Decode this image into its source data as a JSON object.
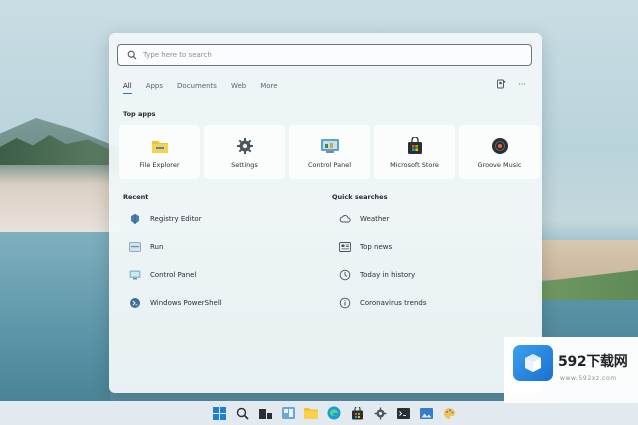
{
  "search": {
    "placeholder": "Type here to search"
  },
  "filters": [
    {
      "label": "All",
      "active": true
    },
    {
      "label": "Apps",
      "active": false
    },
    {
      "label": "Documents",
      "active": false
    },
    {
      "label": "Web",
      "active": false
    },
    {
      "label": "More",
      "active": false
    }
  ],
  "tools": {
    "more": "···"
  },
  "sections": {
    "top_apps": "Top apps",
    "recent": "Recent",
    "quick_searches": "Quick searches"
  },
  "top_apps": [
    {
      "label": "File Explorer",
      "icon": "folder-icon"
    },
    {
      "label": "Settings",
      "icon": "gear-icon"
    },
    {
      "label": "Control Panel",
      "icon": "control-panel-icon"
    },
    {
      "label": "Microsoft Store",
      "icon": "store-icon"
    },
    {
      "label": "Groove Music",
      "icon": "music-icon"
    }
  ],
  "recent": [
    {
      "label": "Registry Editor",
      "icon": "registry-icon"
    },
    {
      "label": "Run",
      "icon": "run-icon"
    },
    {
      "label": "Control Panel",
      "icon": "control-panel-icon"
    },
    {
      "label": "Windows PowerShell",
      "icon": "powershell-icon"
    }
  ],
  "quick_searches": [
    {
      "label": "Weather",
      "icon": "weather-icon"
    },
    {
      "label": "Top news",
      "icon": "news-icon"
    },
    {
      "label": "Today in history",
      "icon": "clock-icon"
    },
    {
      "label": "Coronavirus trends",
      "icon": "info-icon"
    }
  ],
  "taskbar": [
    "windows-logo-icon",
    "search-icon",
    "task-view-icon",
    "widgets-icon",
    "file-explorer-icon",
    "edge-icon",
    "store-icon",
    "settings-icon",
    "cmd-icon",
    "photos-icon",
    "paint-icon"
  ],
  "watermark": {
    "title": "592下载网",
    "url": "www.592xz.com"
  },
  "colors": {
    "accent": "#2b6cb0",
    "folder": "#f2c230",
    "store": "#2a2f34"
  }
}
